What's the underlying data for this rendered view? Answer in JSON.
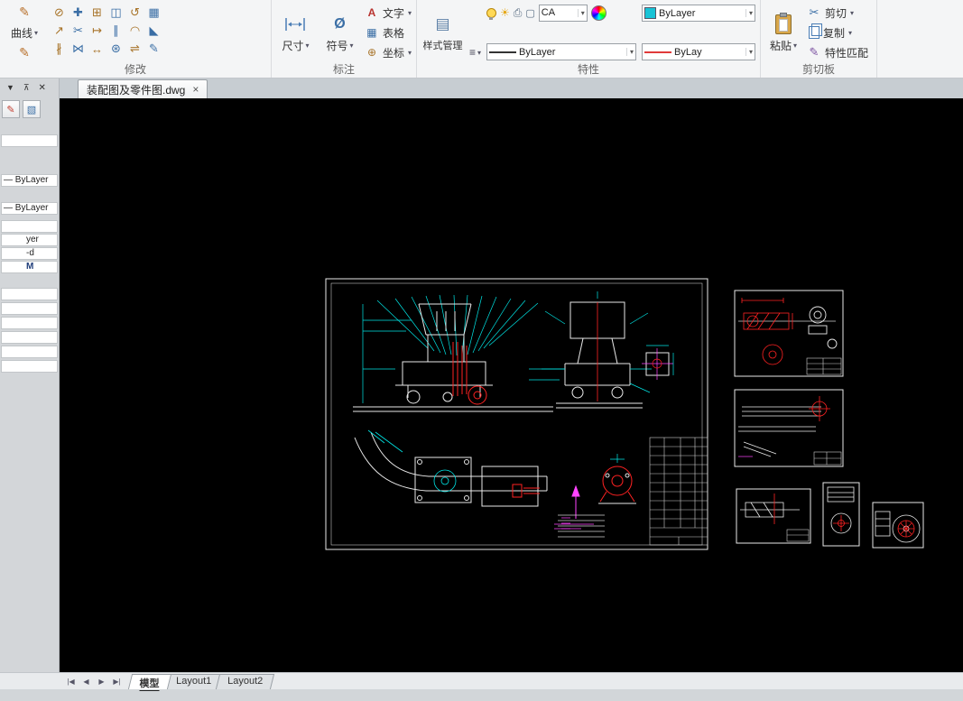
{
  "colors": {
    "canvas_bg": "#000000",
    "cad_white": "#e9e9e9",
    "cad_cyan": "#00e5e5",
    "cad_red": "#ff2222",
    "cad_magenta": "#ff44ff",
    "layer_swatch_cyan": "#19c3d6",
    "lineweight_red": "#e03a3a"
  },
  "ribbon": {
    "modify": {
      "panel_label": "修改",
      "curve_label": "曲线",
      "caret": "▾",
      "pencil_glyph": "✎",
      "tool_glyphs": [
        "⊘",
        "✚",
        "⊞",
        "◫",
        "↺",
        "▦",
        "↗",
        "✂",
        "↦",
        "∥",
        "◠",
        "◣",
        "∦",
        "⋈",
        "↔",
        "⊛",
        "⇌",
        "✎"
      ]
    },
    "annotate": {
      "panel_label": "标注",
      "dimension_label": "尺寸",
      "symbol_label": "符号",
      "symbol_glyph": "Ø",
      "caret": "▾",
      "text_glyph": "A",
      "text_label": "文字",
      "table_glyph": "▦",
      "table_label": "表格",
      "coord_glyph": "⊕",
      "coord_label": "坐标"
    },
    "properties": {
      "panel_label": "特性",
      "style_manager_label": "样式管理",
      "style_glyph": "▤",
      "list_glyph": "≡",
      "caret": "▾",
      "sun_glyph": "☀",
      "printer_glyph": "⎙",
      "frame_glyph": "▢",
      "layer_name_value": "CA",
      "linetype_value": "ByLayer",
      "layer_color_value": "ByLayer",
      "lineweight_value": "ByLay"
    },
    "clipboard": {
      "panel_label": "剪切板",
      "paste_label": "粘贴",
      "cut_label": "剪切",
      "cut_glyph": "✂",
      "copy_label": "复制",
      "match_label": "特性匹配",
      "match_glyph": "✎",
      "caret": "▾"
    }
  },
  "doc_tab": {
    "title": "装配图及零件图.dwg",
    "close_glyph": "×"
  },
  "palette": {
    "menu_glyph": "▼",
    "pin_glyph": "⊼",
    "close_glyph": "✕",
    "tool1_glyph": "✎",
    "tool2_glyph": "▧",
    "rows": [
      "",
      "— ByLayer",
      "— ByLayer",
      "",
      "yer",
      "-d",
      "M",
      "",
      "",
      "",
      "",
      "",
      ""
    ]
  },
  "statusbar": {
    "nav": [
      "|◀",
      "◀",
      "▶",
      "▶|"
    ],
    "model_tab": "模型",
    "layout1_tab": "Layout1",
    "layout2_tab": "Layout2"
  }
}
